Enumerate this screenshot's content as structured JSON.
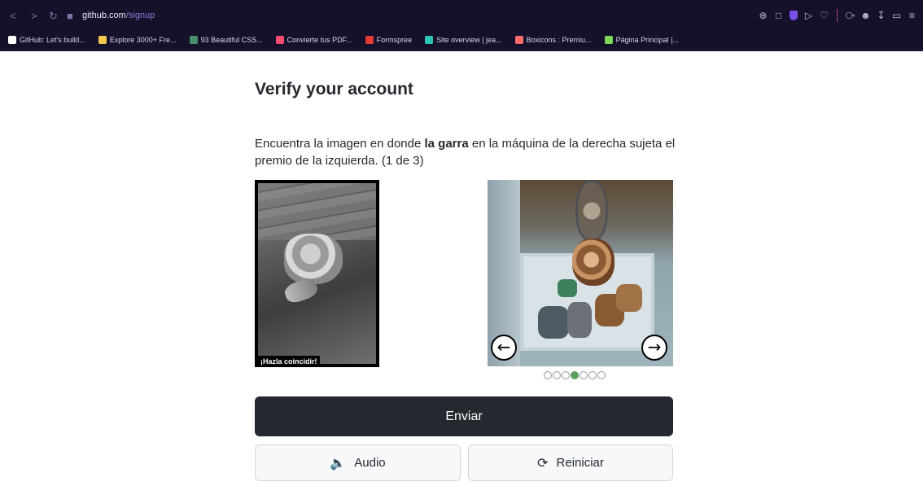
{
  "browser": {
    "url_host": "github.com",
    "url_path": "/signup",
    "bookmarks": [
      {
        "label": "GitHub: Let's build...",
        "color": "#ffffff"
      },
      {
        "label": "Explore 3000+ Fre...",
        "color": "#f2c94c"
      },
      {
        "label": "93 Beautiful CSS...",
        "color": "#4a8f6a"
      },
      {
        "label": "Convierte tus PDF...",
        "color": "#ff4d6d"
      },
      {
        "label": "Formspree",
        "color": "#e53935"
      },
      {
        "label": "Site overview | jea...",
        "color": "#2ec4b6"
      },
      {
        "label": "Boxicons : Premiu...",
        "color": "#ff6b6b"
      },
      {
        "label": "Página Principal |...",
        "color": "#7ed957"
      }
    ]
  },
  "page": {
    "title": "Verify your account",
    "instruction_pre": "Encuentra la imagen en donde ",
    "instruction_bold": "la garra",
    "instruction_post": " en la máquina de la derecha sujeta el premio de la izquierda. (1 de 3)",
    "reference_caption": "¡Hazla coincidir!",
    "carousel": {
      "total": 7,
      "active_index": 3
    },
    "submit_label": "Enviar",
    "audio_label": "Audio",
    "reset_label": "Reiniciar"
  },
  "colors": {
    "accent_dot": "#5c9e5c",
    "primary_button": "#24292f",
    "chrome_bg": "#15112a"
  }
}
